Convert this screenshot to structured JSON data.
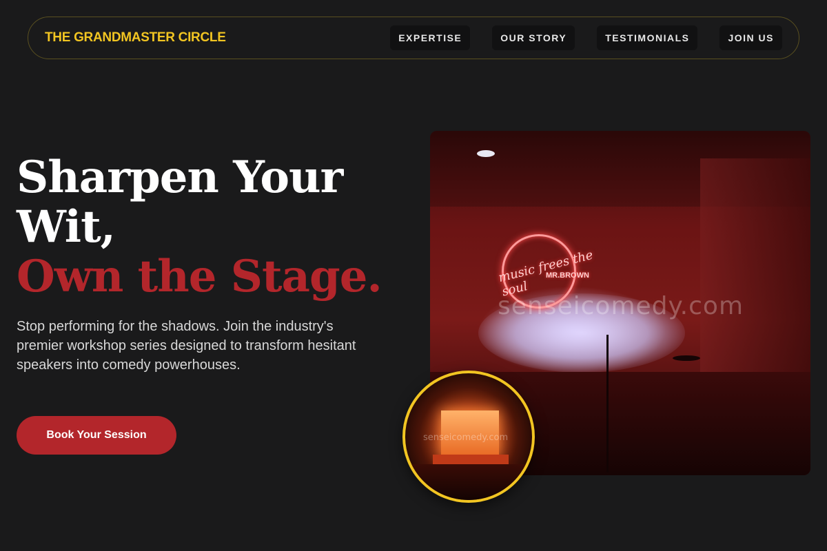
{
  "header": {
    "brand": "THE GRANDMASTER CIRCLE",
    "nav": [
      {
        "label": "EXPERTISE"
      },
      {
        "label": "OUR STORY"
      },
      {
        "label": "TESTIMONIALS"
      },
      {
        "label": "JOIN US"
      }
    ]
  },
  "hero": {
    "headline_line1": "Sharpen Your",
    "headline_line2": "Wit,",
    "headline_accent": "Own the Stage.",
    "description": "Stop performing for the shadows. Join the industry's premier workshop series designed to transform hesitant speakers into comedy powerhouses.",
    "cta_label": "Book Your Session"
  },
  "images": {
    "main_photo": {
      "neon_text": "music frees the soul",
      "neon_subtext": "MR.BROWN",
      "watermark": "senseicomedy.com"
    },
    "inset_photo": {
      "watermark": "senseicomedy.com"
    }
  },
  "colors": {
    "background": "#1a1a1b",
    "brand_yellow": "#f2c522",
    "accent_red": "#b3262b",
    "nav_button_bg": "#111112"
  }
}
